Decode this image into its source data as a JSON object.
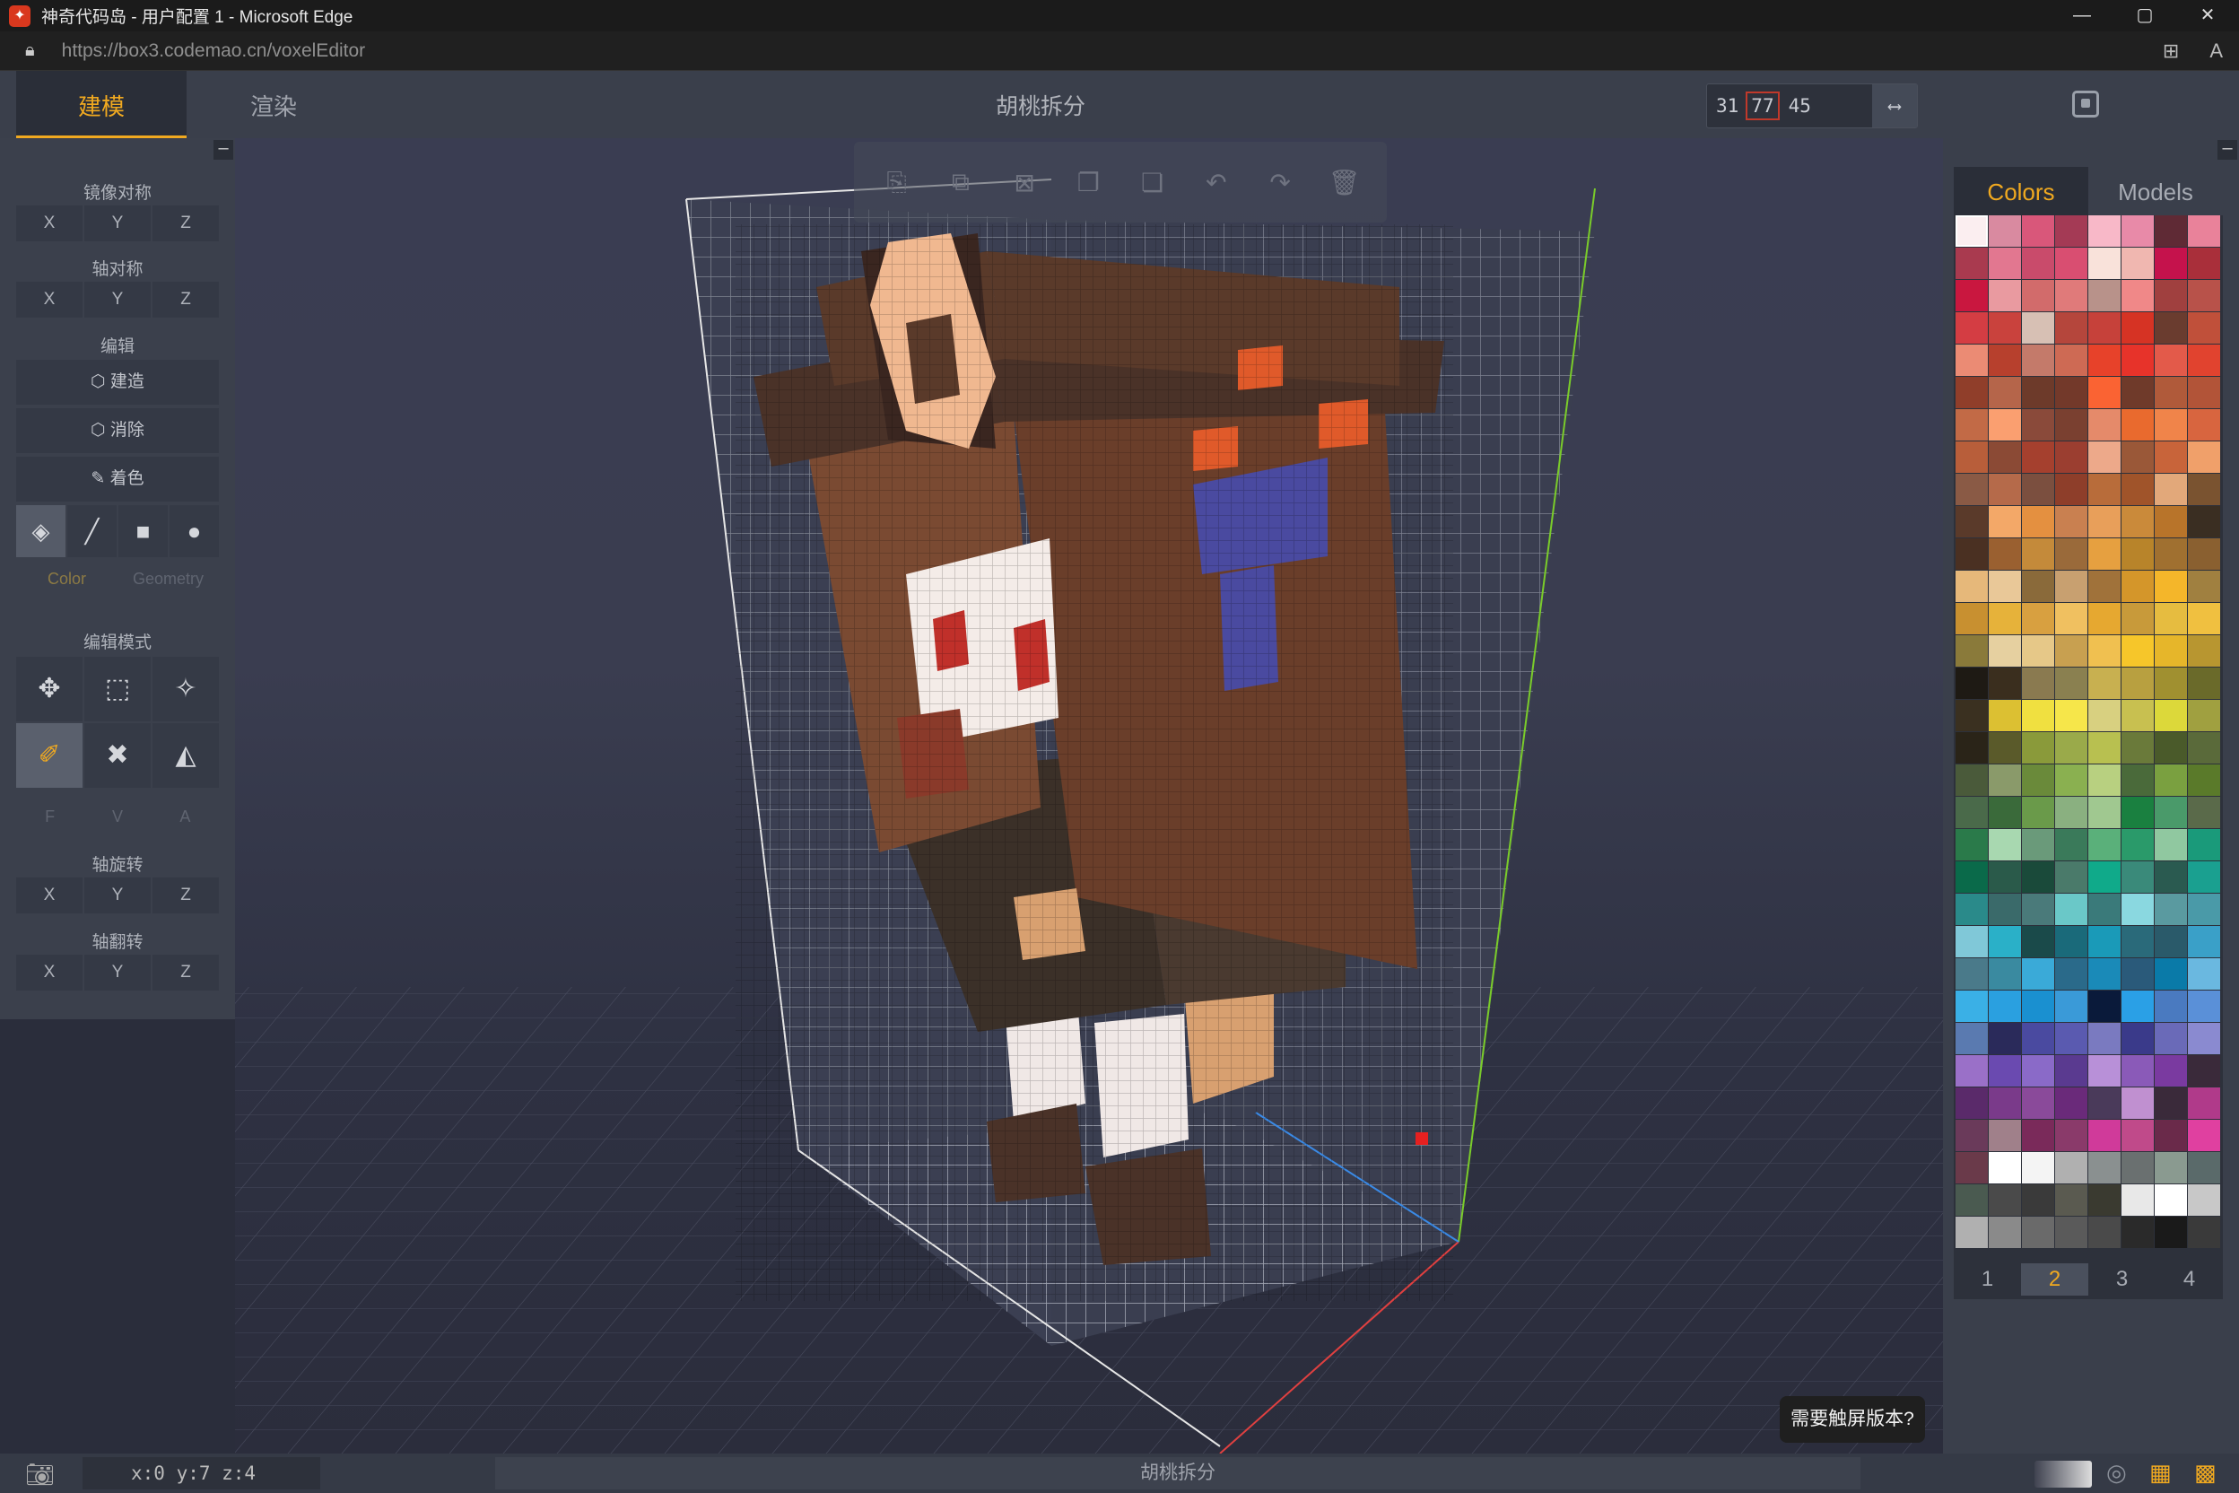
{
  "browser": {
    "window_title": "神奇代码岛 - 用户配置 1 - Microsoft Edge",
    "url_host": "https://box3.codemao.cn",
    "url_path": "/voxelEditor",
    "win_minimize": "—",
    "win_maximize": "▢",
    "win_close": "✕"
  },
  "header": {
    "tab_build": "建模",
    "tab_render": "渲染",
    "project_title": "胡桃拆分",
    "dims": {
      "x": "31",
      "y": "77",
      "z": "45"
    }
  },
  "left_panel": {
    "mirror_label": "镜像对称",
    "axis_sym_label": "轴对称",
    "edit_label": "编辑",
    "build_label": "建造",
    "erase_label": "消除",
    "paint_label": "着色",
    "color_label": "Color",
    "geometry_label": "Geometry",
    "edit_mode_label": "编辑模式",
    "fva": [
      "F",
      "V",
      "A"
    ],
    "rotate_label": "轴旋转",
    "flip_label": "轴翻转",
    "axes": [
      "X",
      "Y",
      "Z"
    ]
  },
  "palette": {
    "tab_colors": "Colors",
    "tab_models": "Models",
    "pages": [
      "1",
      "2",
      "3",
      "4"
    ],
    "active_page": "2",
    "swatches": [
      "#fbeef0",
      "#d98aa0",
      "#d9577a",
      "#a43a55",
      "#f8b8c8",
      "#e88aa8",
      "#5f2a35",
      "#e9829a",
      "#a93a4f",
      "#e27790",
      "#c94b6b",
      "#d94e71",
      "#f9e2da",
      "#f0b7b0",
      "#c5124c",
      "#a92f3a",
      "#c9173f",
      "#e99aa0",
      "#d26b6b",
      "#e07a7a",
      "#b8928a",
      "#f08888",
      "#a0403f",
      "#b8524a",
      "#d43d43",
      "#c9423d",
      "#d7c0b4",
      "#b5463c",
      "#c6413a",
      "#d63324",
      "#6a3c2f",
      "#c0503a",
      "#eb8b74",
      "#b7402d",
      "#c47a6a",
      "#ce6a54",
      "#e7422a",
      "#e7332a",
      "#e35a4a",
      "#e1432f",
      "#903e2a",
      "#b5654a",
      "#6d3a2a",
      "#73392a",
      "#fa6333",
      "#6f3a2a",
      "#b05a3a",
      "#b25438",
      "#c26a46",
      "#fa9f70",
      "#8a4a3a",
      "#7a4030",
      "#e58a6a",
      "#e96a2e",
      "#f0844a",
      "#d8653f",
      "#b85e3a",
      "#8b4a35",
      "#a5402e",
      "#9b3e30",
      "#eda98a",
      "#9a5838",
      "#c8643a",
      "#f0a06a",
      "#8a5a45",
      "#b56a4a",
      "#7b4f3f",
      "#8e3e2a",
      "#b86c3a",
      "#a0542a",
      "#e2a87a",
      "#7a5330",
      "#5a3a2a",
      "#f3a868",
      "#e49040",
      "#c98050",
      "#e89f5a",
      "#ca8a3a",
      "#b8742a",
      "#3a2e22",
      "#4a3022",
      "#9a6030",
      "#c48a3a",
      "#9a6a3a",
      "#e6a040",
      "#b8842a",
      "#a07030",
      "#8a6030",
      "#e6b87a",
      "#e9c898",
      "#8a6a3a",
      "#c8a070",
      "#a0723a",
      "#d4962a",
      "#f4b62a",
      "#a08040",
      "#c89030",
      "#e6b23a",
      "#d8a040",
      "#f0c060",
      "#e6a830",
      "#c89a3a",
      "#e6bc40",
      "#f0c040",
      "#8a7a3a",
      "#e6d0a0",
      "#e6c888",
      "#c8a050",
      "#f0c050",
      "#f6c62a",
      "#e6b62a",
      "#b89630",
      "#1e1a14",
      "#3a2e1e",
      "#8a7a50",
      "#8a8050",
      "#c8b050",
      "#b8a040",
      "#a09030",
      "#6a6a2a",
      "#3a3020",
      "#dcc032",
      "#f0e040",
      "#f6e64a",
      "#d8d080",
      "#c8c050",
      "#dcd83a",
      "#a0a040",
      "#2a2418",
      "#5a5a2a",
      "#8a9a3a",
      "#9aaa4a",
      "#b8c050",
      "#6a7a3a",
      "#4a5a2a",
      "#5a6a3a",
      "#4a5a3a",
      "#8a9a6a",
      "#6a8a3a",
      "#8ab050",
      "#b8d080",
      "#4a6a3a",
      "#7aa040",
      "#5a7a2a",
      "#4a6a4a",
      "#3a6a3a",
      "#6a9a4a",
      "#8ab080",
      "#a0c890",
      "#1a8040",
      "#4a9a6a",
      "#5a6a4a",
      "#2a7a4a",
      "#a8d8b0",
      "#6a9a7a",
      "#3a7a5a",
      "#5ab07a",
      "#2a9a6a",
      "#90c8a0",
      "#1a9a7a",
      "#0a6a4a",
      "#2a5a4a",
      "#1a4a3a",
      "#4a7a6a",
      "#10aa8a",
      "#3a8a7a",
      "#2a5a50",
      "#1aa090",
      "#2a8a8a",
      "#3a6a6a",
      "#4a7a7a",
      "#6ac8c8",
      "#3a7a7a",
      "#8ad8e0",
      "#5a9aa0",
      "#4a9aa8",
      "#80c8d8",
      "#2ab0c8",
      "#1a4a4a",
      "#1a6a7a",
      "#1a9ab8",
      "#2a6a7a",
      "#2a5a6a",
      "#3aa0c8",
      "#4a7a8a",
      "#3a8aa0",
      "#3aaad8",
      "#2a6a8a",
      "#1a8ab8",
      "#2a5a7a",
      "#0a7aa8",
      "#6ab8e0",
      "#3ab0e6",
      "#2aa0e0",
      "#1a90d0",
      "#3a9ad8",
      "#0a1a3a",
      "#2aa0e6",
      "#4a7ac0",
      "#5a90d8",
      "#5a7ab0",
      "#2a2a5a",
      "#4a4aa0",
      "#5a5ab0",
      "#7a7ac0",
      "#3a3a8a",
      "#6a6ab8",
      "#8a8ad0",
      "#9a70c8",
      "#6a4ab0",
      "#8a6ac8",
      "#5a3a90",
      "#b890d8",
      "#8a5ab8",
      "#7a3aa0",
      "#3a2a3a",
      "#5a2a6a",
      "#7a3a8a",
      "#8a4a9a",
      "#6a2a7a",
      "#4a3a5a",
      "#c090d0",
      "#3a2a3a",
      "#b03a8a",
      "#6a3a5a",
      "#a0808a",
      "#7a2a5a",
      "#8a3a6a",
      "#d03a9a",
      "#c04a8a",
      "#6a2a4a",
      "#e040a0",
      "#6a3a4a",
      "#ffffff",
      "#f4f4f4",
      "#b0b0b0",
      "#8a9090",
      "#6a7070",
      "#8a9a90",
      "#5a6a6a",
      "#4a5a50",
      "#4a4a4a",
      "#3a3a3a",
      "#5a5a50",
      "#3a3a30",
      "#e8e8e8",
      "#ffffff",
      "#c8c8c8",
      "#b0b0b0",
      "#8a8a8a",
      "#6a6a6a",
      "#5a5a5a",
      "#4a4a4a",
      "#2a2a2a",
      "#1a1a1a",
      "#3a3a3a"
    ]
  },
  "status": {
    "coords": "x:0 y:7 z:4",
    "center": "胡桃拆分",
    "touch_tooltip": "需要触屏版本?"
  }
}
